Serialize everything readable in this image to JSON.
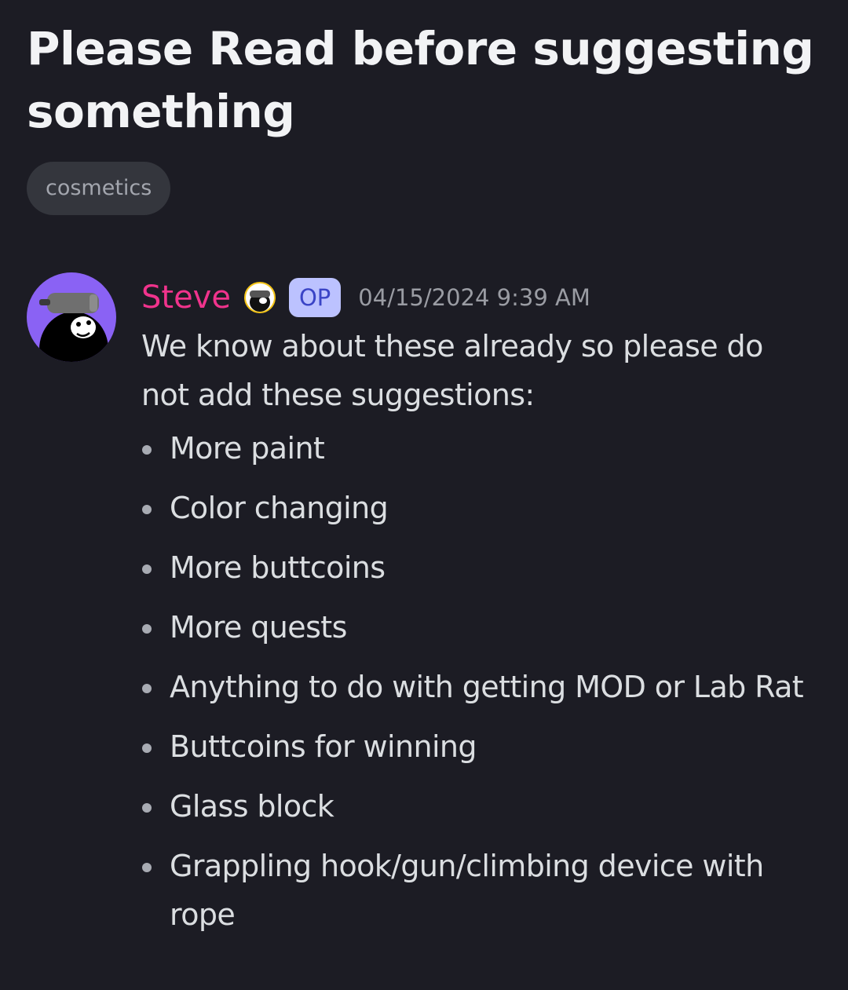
{
  "thread": {
    "title": "Please Read before suggesting something",
    "tag": "cosmetics"
  },
  "post": {
    "author": {
      "name": "Steve",
      "name_color": "#f0338c",
      "avatar_icon": "vr-headset-gorilla-avatar",
      "role_icon": "gorilla-role-icon",
      "badge": "OP"
    },
    "timestamp": "04/15/2024 9:39 AM",
    "intro": "We know about these already so please do not add these suggestions:",
    "bullets": [
      "More paint",
      "Color changing",
      "More buttcoins",
      "More quests",
      "Anything to do with getting MOD or Lab Rat",
      "Buttcoins for winning",
      "Glass block",
      "Grappling hook/gun/climbing device with rope"
    ]
  },
  "colors": {
    "background": "#1c1c24",
    "accent_purple": "#8a62f4",
    "op_badge_bg": "#bcc2ff",
    "op_badge_text": "#3a44c6"
  }
}
